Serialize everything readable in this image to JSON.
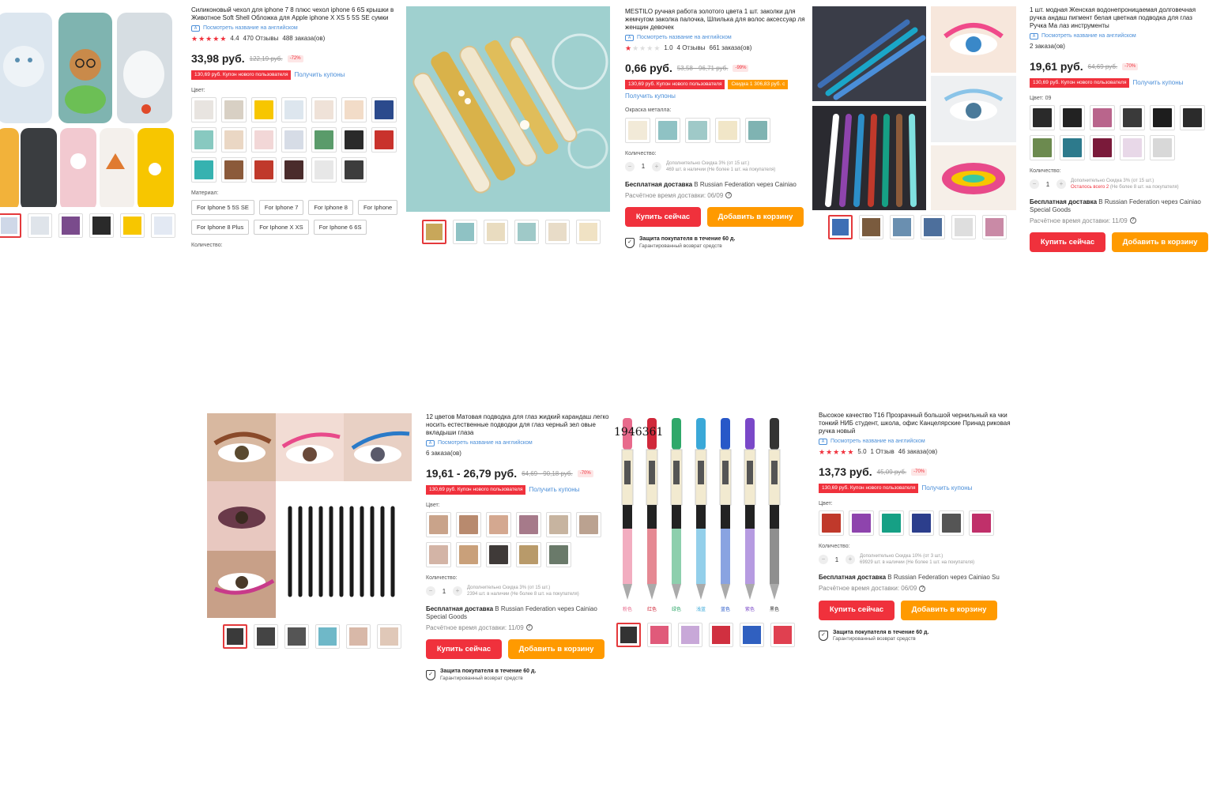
{
  "products": [
    {
      "title": "Силиконовый чехол для iphone 7 8 плюс чехол iphone 6 6S крышки в Животное Soft Shell Обложка для Apple iphone X XS 5 5S SE сумки",
      "translate_link": "Посмотреть название на английском",
      "rating": "4.4",
      "reviews": "470 Отзывы",
      "orders": "488 заказа(ов)",
      "price": "33,98 руб.",
      "old_price": "122,19 руб.",
      "discount": "-72%",
      "coupon": "130,69 руб. Купон нового пользователя",
      "get_coupons": "Получить купоны",
      "color_label": "Цвет:",
      "material_label": "Материал:",
      "materials": [
        "For Iphone 5 5S SE",
        "For Iphone 7",
        "For Iphone 8",
        "For Iphone",
        "For Iphone 8 Plus",
        "For Iphone X XS",
        "For Iphone 6 6S"
      ],
      "qty_label": "Количество:",
      "swatch_colors": [
        "#e8e4e0",
        "#d8d0c4",
        "#f7c600",
        "#dde6ee",
        "#efe2d8",
        "#f2dcc8",
        "#2b4a8c",
        "#88c9c0",
        "#ead7c4",
        "#f2d7d7",
        "#d6dce6",
        "#5a9b6a",
        "#2a2a2a",
        "#c9322c",
        "#36b2b0",
        "#8b5a3a",
        "#c0392b",
        "#4a2c2c",
        "#e7e7e7",
        "#3d3d3d"
      ],
      "thumb_colors": [
        "#cfd8e8",
        "#dfe4ea",
        "#7a4b8c",
        "#2a2a2a",
        "#f7c600",
        "#e3e9f3"
      ]
    },
    {
      "title": "MESTILO ручная работа золотого цвета 1 шт. заколки для жемчугом заколка палочка, Шпилька для волос аксессуар ля женщин девочек",
      "translate_link": "Посмотреть название на английском",
      "rating": "1.0",
      "reviews": "4 Отзывы",
      "orders": "661 заказа(ов)",
      "price": "0,66 руб.",
      "old_price": "53,58 - 96,71 руб.",
      "discount": "-99%",
      "coupon": "130,69 руб. Купон нового пользователя",
      "coupon2": "Скидка 1 306,83 руб. с",
      "get_coupons": "Получить купоны",
      "metal_label": "Окраска металла:",
      "qty_label": "Количество:",
      "qty": "1",
      "qty_note1": "Дополнительно Скидка 3% (от 15 шт.)",
      "qty_note2": "469 шт. в наличии (Не более 1 шт. на покупателя)",
      "ship_bold": "Бесплатная доставка",
      "ship_rest": " В Russian Federation через Cainiao",
      "eta": "Расчётное время доставки: 06/09",
      "buy": "Купить сейчас",
      "cart": "Добавить в корзину",
      "prot1": "Защита покупателя в течение 60 д.",
      "prot2": "Гарантированный возврат средств",
      "swatch_colors": [
        "#f2ead8",
        "#8fc2c4",
        "#9fc9c8",
        "#f1e6c8",
        "#7fb3b2"
      ],
      "thumb_colors": [
        "#c8a75a",
        "#8fc2c4",
        "#e9dcc0",
        "#9fc9c8",
        "#e8dcc8",
        "#f0e2c4"
      ]
    },
    {
      "title": "1 шт. модная Женская водонепроницаемая долговечная ручка андаш пигмент белая цветная подводка для глаз Ручка Ма лаз инструменты",
      "translate_link": "Посмотреть название на английском",
      "orders": "2 заказа(ов)",
      "price": "19,61 руб.",
      "old_price": "64,69 руб.",
      "discount": "-70%",
      "coupon": "130,69 руб. Купон нового пользователя",
      "get_coupons": "Получить купоны",
      "color_label": "Цвет: 09",
      "qty_label": "Количество:",
      "qty": "1",
      "qty_note1": "Дополнительно Скидка 3% (от 15 шт.)",
      "qty_note2_red": "Осталось всего 2",
      "qty_note2": " (Не более 8 шт. на покупателя)",
      "ship_bold": "Бесплатная доставка",
      "ship_rest": " В Russian Federation через Cainiao Special Goods",
      "eta": "Расчётное время доставки: 11/09",
      "buy": "Купить сейчас",
      "cart": "Добавить в корзину",
      "swatch_colors": [
        "#2a2a2a",
        "#222222",
        "#b9658c",
        "#3a3a3a",
        "#1d1d1d",
        "#2b2b2b",
        "#6c8a4f",
        "#2d7a8c",
        "#7a1a3a",
        "#e8d8e8",
        "#d8d8d8"
      ],
      "thumb_colors": [
        "#3d6fb5",
        "#7a5b3e",
        "#6a8fb0",
        "#4d6f9c",
        "#dedede",
        "#c98aa6"
      ]
    },
    {
      "title": "12 цветов Матовая подводка для глаз жидкий карандаш легко носить естественные подводки для глаз черный зел овые вкладыши глаза",
      "translate_link": "Посмотреть название на английском",
      "orders": "6 заказа(ов)",
      "price": "19,61 - 26,79 руб.",
      "old_price": "64,69 - 90,18 руб.",
      "discount": "-70%",
      "coupon": "130,69 руб. Купон нового пользователя",
      "get_coupons": "Получить купоны",
      "color_label": "Цвет:",
      "qty_label": "Количество:",
      "qty": "1",
      "qty_note1": "Дополнительно Скидка 3% (от 15 шт.)",
      "qty_note2": "2394 шт. в наличии (Не более 8 шт. на покупателя)",
      "ship_bold": "Бесплатная доставка",
      "ship_rest": " В Russian Federation через Cainiao Special Goods",
      "eta": "Расчётное время доставки: 11/09",
      "buy": "Купить сейчас",
      "cart": "Добавить в корзину",
      "prot1": "Защита покупателя в течение 60 д.",
      "prot2": "Гарантированный возврат средств",
      "swatch_colors": [
        "#c9a38a",
        "#b88a6e",
        "#d4a890",
        "#a67a8a",
        "#c7b4a0",
        "#bba290",
        "#d3b4a6",
        "#c9a07a",
        "#3f3a38",
        "#b89a6a",
        "#6a7a6a"
      ],
      "thumb_colors": [
        "#3a3a3a",
        "#444444",
        "#555555",
        "#6fb8c8",
        "#d8b8a8",
        "#e0c8b8"
      ]
    },
    {
      "caption": "1946361",
      "thumb_colors": [
        "#333333",
        "#e05a7a",
        "#c8a8d8",
        "#d03040",
        "#3060c0",
        "#e04050"
      ]
    },
    {
      "title": "Высокое качество T16 Прозрачный большой чернильный ка чки тонкий НИБ студент, школа, офис Канцелярские Принад риковая ручка новый",
      "translate_link": "Посмотреть название на английском",
      "rating": "5.0",
      "reviews": "1 Отзыв",
      "orders": "46 заказа(ов)",
      "price": "13,73 руб.",
      "old_price": "45,09 руб.",
      "discount": "-70%",
      "coupon": "130,69 руб. Купон нового пользователя",
      "get_coupons": "Получить купоны",
      "color_label": "Цвет:",
      "qty_label": "Количество:",
      "qty": "1",
      "qty_note1": "Дополнительно Скидка 10% (от 3 шт.)",
      "qty_note2": "69929 шт. в наличии (Не более 1 шт. на покупателя)",
      "ship_bold": "Бесплатная доставка",
      "ship_rest": " В Russian Federation через Cainiao Su",
      "eta": "Расчётное время доставки: 06/09",
      "buy": "Купить сейчас",
      "cart": "Добавить в корзину",
      "prot1": "Защита покупателя в течение 60 д.",
      "prot2": "Гарантированный возврат средств",
      "swatch_colors": [
        "#c0392b",
        "#8e44ad",
        "#16a085",
        "#2c3e8c",
        "#555555",
        "#c0306a"
      ]
    }
  ],
  "pens_labels": [
    "粉色",
    "红色",
    "绿色",
    "浅蓝",
    "蓝色",
    "紫色",
    "黑色"
  ],
  "pens_colors": [
    "#e86a8c",
    "#d0283a",
    "#2fa86a",
    "#3aa8d8",
    "#2858c8",
    "#7a48c8",
    "#333333"
  ]
}
